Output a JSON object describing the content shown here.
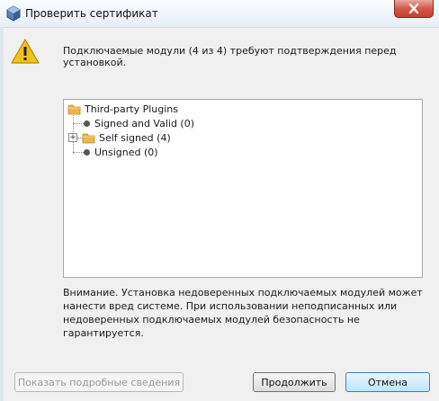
{
  "window": {
    "title": "Проверить сертификат"
  },
  "message": "Подключаемые модули (4 из 4) требуют подтверждения перед установкой.",
  "tree": {
    "root": "Third-party Plugins",
    "items": [
      {
        "label": "Signed and Valid (0)",
        "type": "leaf"
      },
      {
        "label": "Self signed (4)",
        "type": "folder",
        "expanded": false
      },
      {
        "label": "Unsigned (0)",
        "type": "leaf"
      }
    ]
  },
  "notice": "Внимание. Установка недоверенных подключаемых модулей может нанести вред системе. При использовании неподписанных или недоверенных подключаемых модулей безопасность не гарантируется.",
  "buttons": {
    "details": "Показать подробные сведения",
    "continue": "Продолжить",
    "cancel": "Отмена"
  },
  "colors": {
    "accent": "#3c7fb1",
    "close": "#c2402e",
    "folder": "#e8b84a"
  }
}
